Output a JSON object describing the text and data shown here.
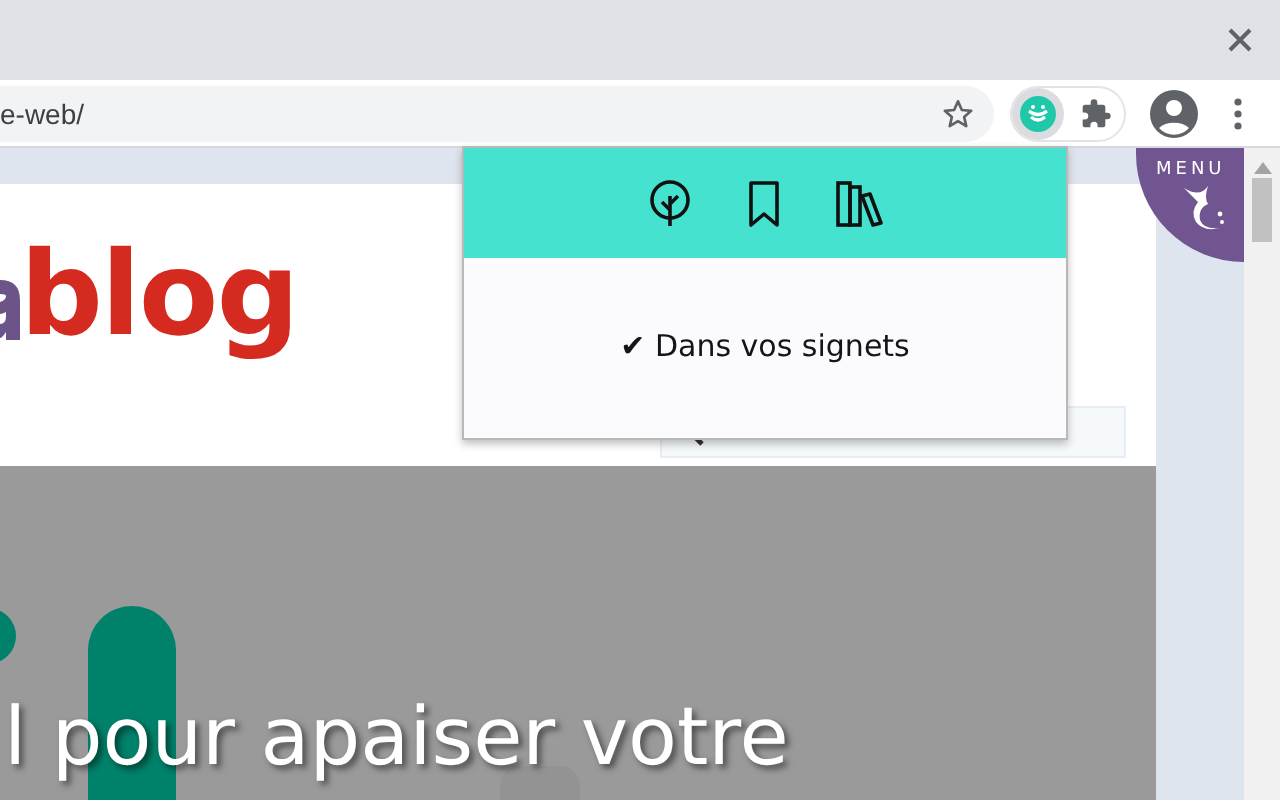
{
  "address_bar": {
    "url": "e-web/"
  },
  "page": {
    "logo": {
      "text": "blog"
    },
    "menu_badge": {
      "label": "MENU"
    },
    "hero": {
      "headline": "l pour apaiser votre"
    }
  },
  "popup": {
    "message": "✔ Dans vos signets"
  }
}
